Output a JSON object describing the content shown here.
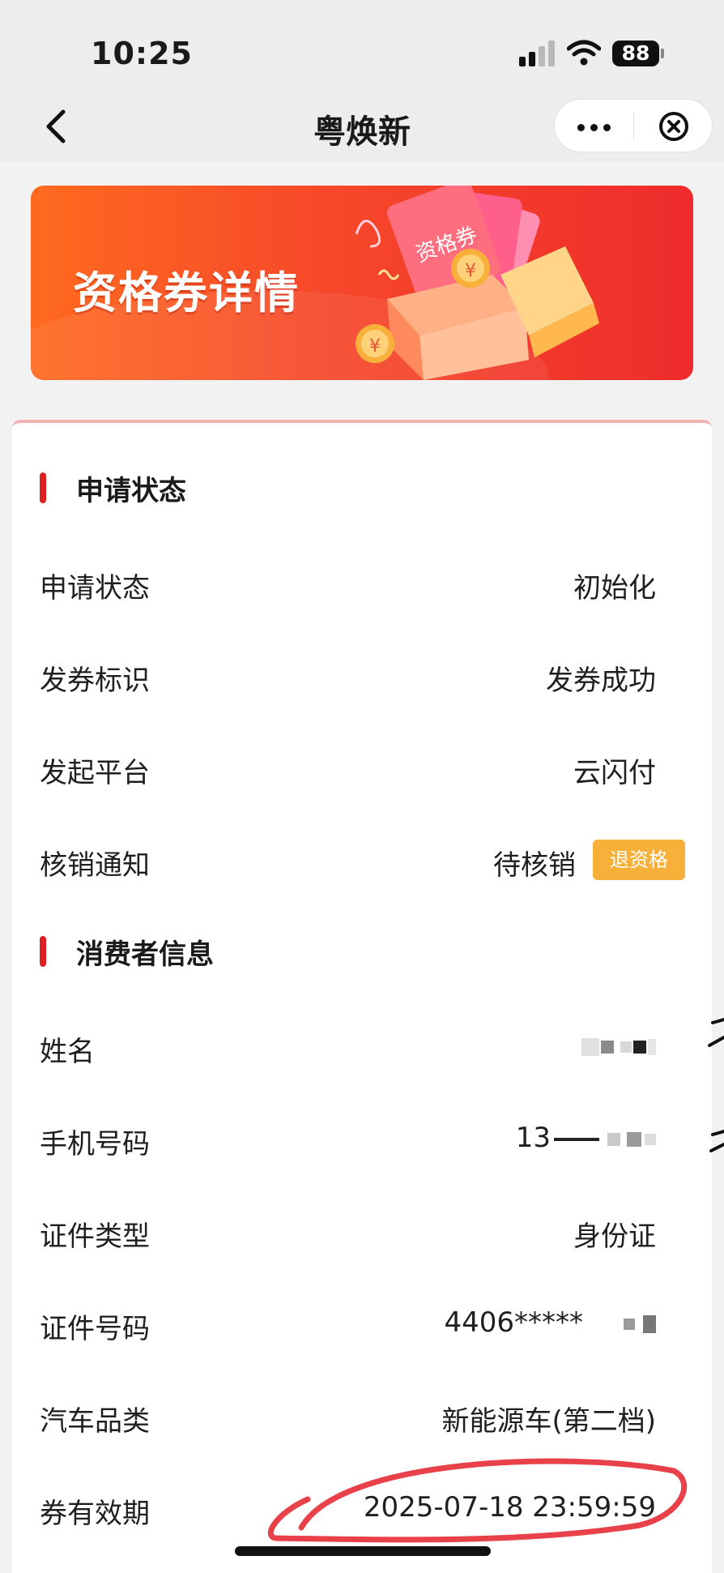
{
  "status_bar": {
    "time": "10:25",
    "battery": "88"
  },
  "nav": {
    "title": "粤焕新"
  },
  "banner": {
    "title": "资格券详情",
    "ticket_text": "资格券",
    "coin_symbol": "¥"
  },
  "sections": {
    "apply_status": {
      "title": "申请状态"
    },
    "consumer_info": {
      "title": "消费者信息"
    }
  },
  "apply_rows": [
    {
      "label": "申请状态",
      "value": "初始化"
    },
    {
      "label": "发券标识",
      "value": "发券成功"
    },
    {
      "label": "发起平台",
      "value": "云闪付"
    },
    {
      "label": "核销通知",
      "value": "待核销",
      "action": "退资格"
    }
  ],
  "consumer_rows": [
    {
      "label": "姓名",
      "value": ""
    },
    {
      "label": "手机号码",
      "value": "13"
    },
    {
      "label": "证件类型",
      "value": "身份证"
    },
    {
      "label": "证件号码",
      "value": "4406*****"
    },
    {
      "label": "汽车品类",
      "value": "新能源车(第二档)"
    },
    {
      "label": "券有效期",
      "value": "2025-07-18 23:59:59"
    }
  ],
  "colors": {
    "accent_red": "#e02020",
    "refund_button": "#f7b13a",
    "banner_start": "#ff6a1f",
    "banner_end": "#ee2c2c",
    "annotation_circle": "#e8414a"
  },
  "icons": {
    "back": "back-arrow-icon",
    "more": "more-dots-icon",
    "close": "close-circle-icon"
  }
}
